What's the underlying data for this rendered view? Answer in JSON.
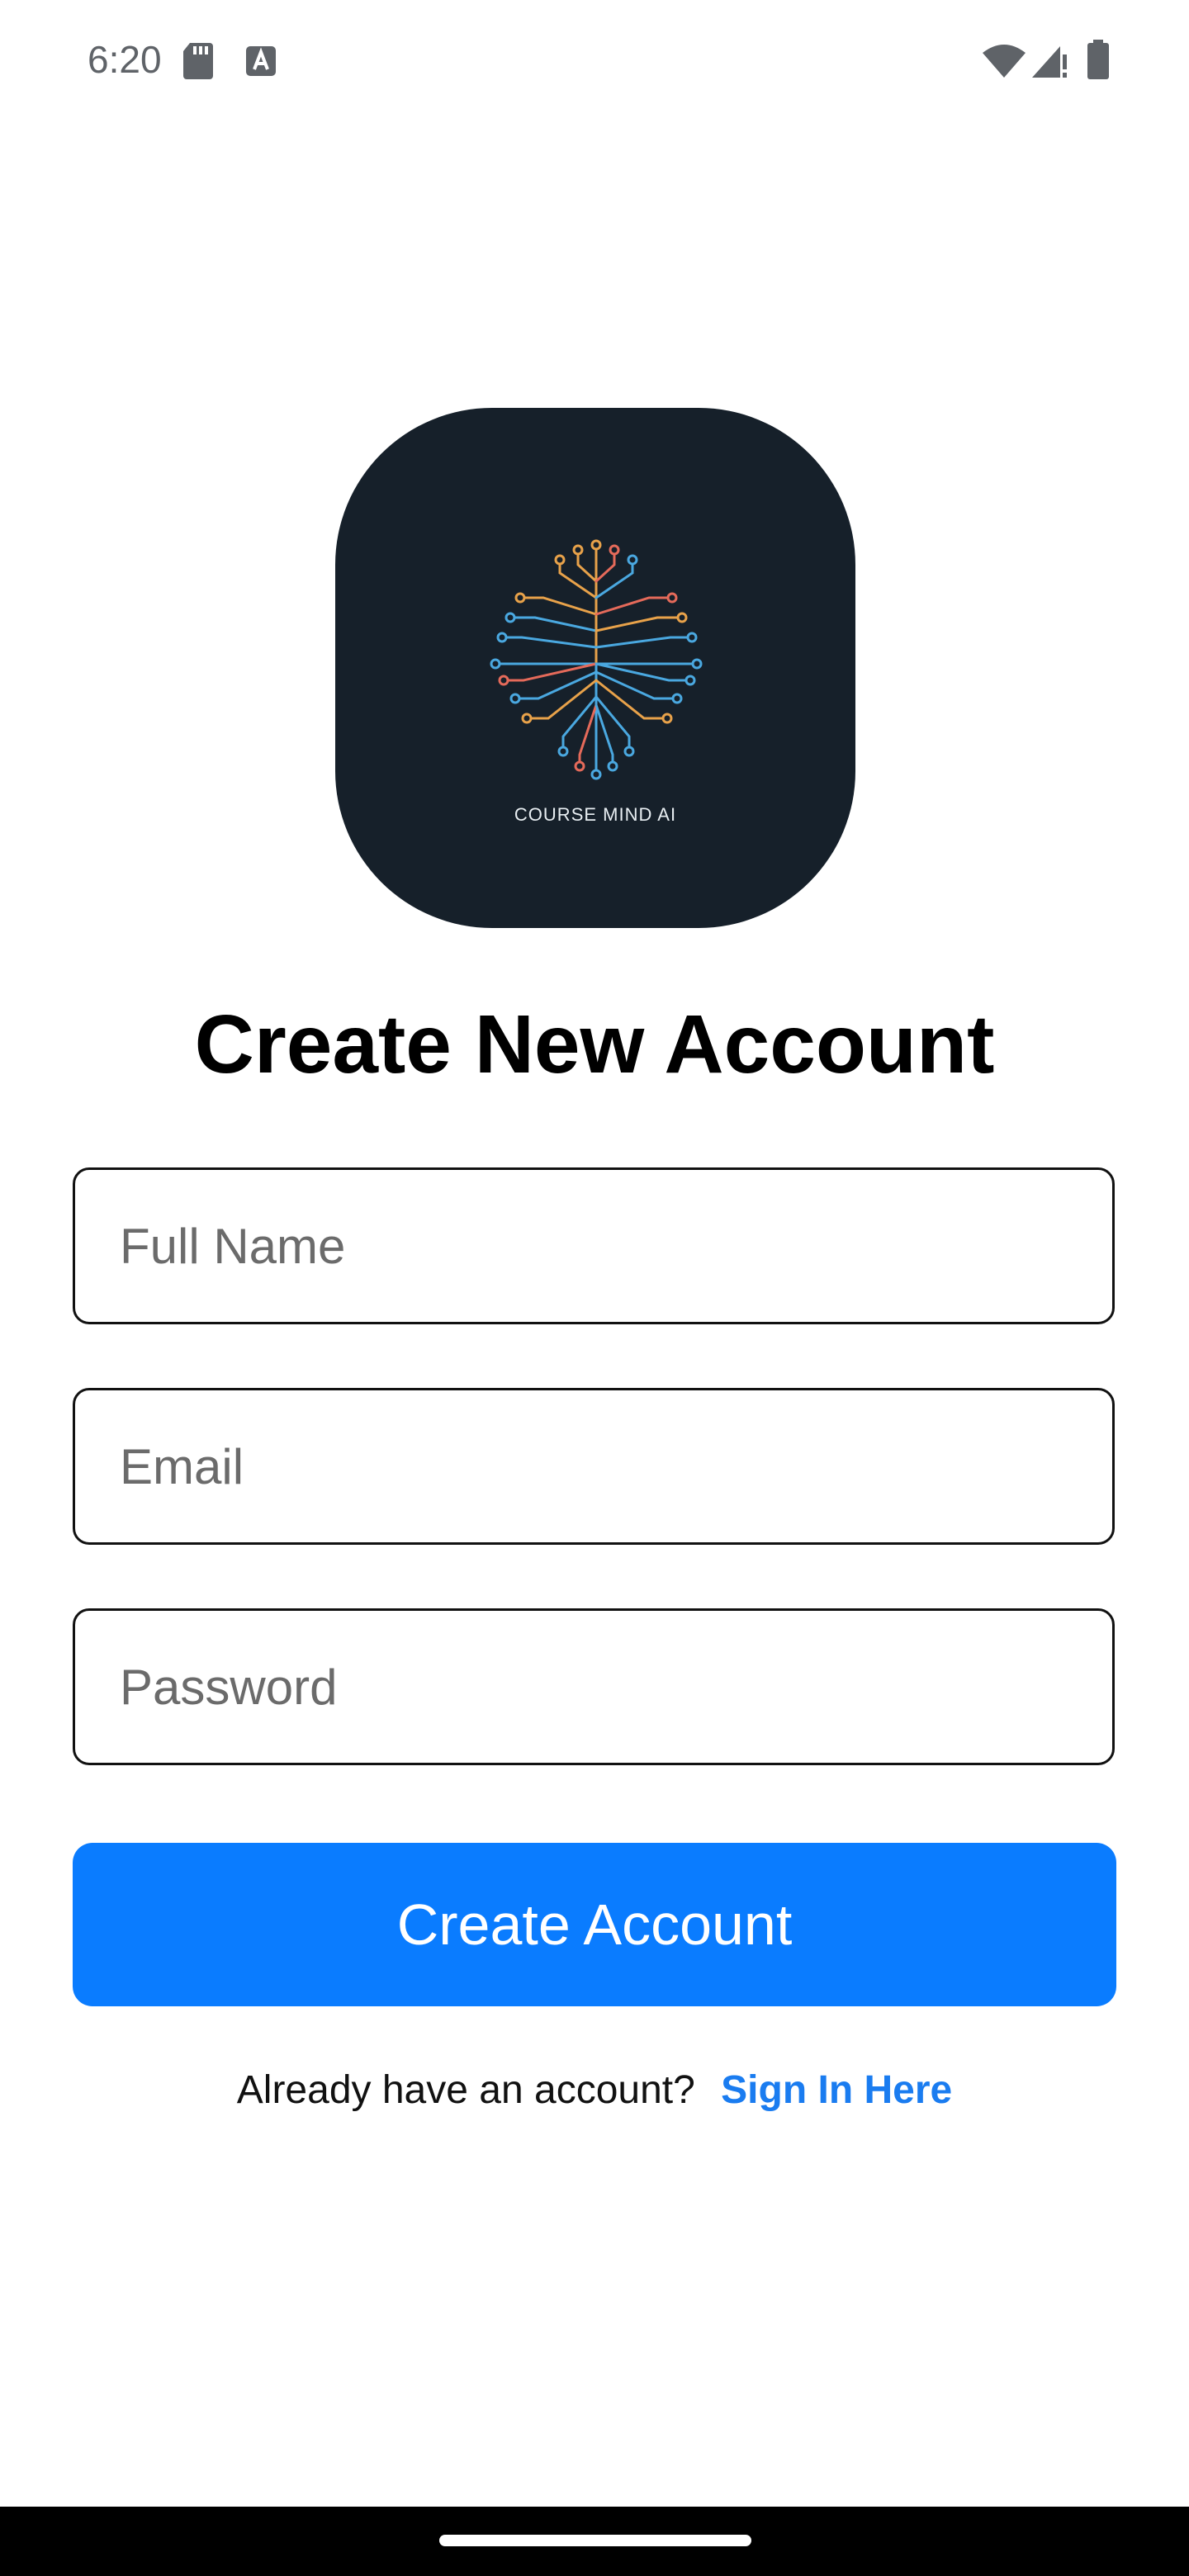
{
  "status_bar": {
    "time": "6:20",
    "icons": [
      "sd-card-icon",
      "keyboard-a-icon",
      "wifi-icon",
      "signal-icon",
      "battery-icon"
    ]
  },
  "logo": {
    "text": "COURSE MIND AI",
    "background_color": "#16202a"
  },
  "page": {
    "title": "Create New Account"
  },
  "form": {
    "full_name": {
      "placeholder": "Full Name",
      "value": ""
    },
    "email": {
      "placeholder": "Email",
      "value": ""
    },
    "password": {
      "placeholder": "Password",
      "value": ""
    },
    "submit_label": "Create Account"
  },
  "footer": {
    "prompt": "Already have an account?",
    "link_label": "Sign In Here"
  },
  "colors": {
    "accent": "#0a7cff",
    "link": "#1a7cf0"
  }
}
